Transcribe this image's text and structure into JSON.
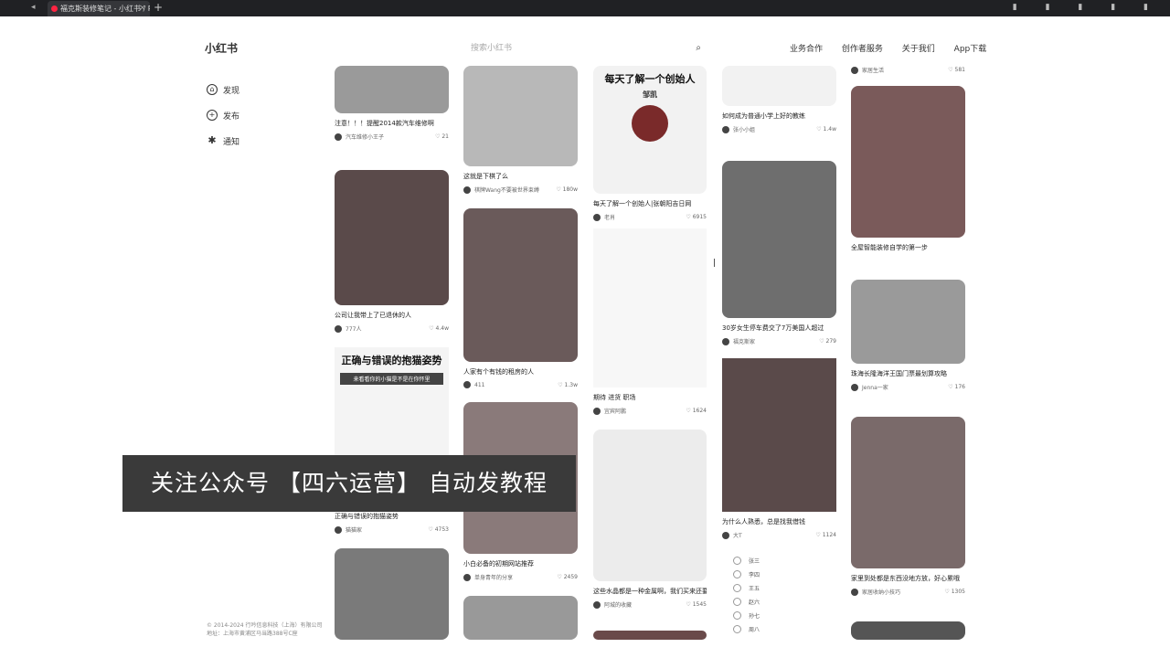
{
  "browser": {
    "tab_title": "福克斯装修笔记 - 小红书 / RED",
    "close_label": "×",
    "new_tab_label": "+",
    "back_label": "◂",
    "window_controls": "▮ ▮ ▮ ▮ ▮"
  },
  "header": {
    "logo": "小红书",
    "search_placeholder": "搜索小红书",
    "search_icon": "search-icon",
    "nav": [
      "业务合作",
      "创作者服务",
      "关于我们",
      "App下载"
    ]
  },
  "sidebar": {
    "items": [
      {
        "label": "发现",
        "icon": "home-icon",
        "glyph": "⌂"
      },
      {
        "label": "发布",
        "icon": "plus-icon",
        "glyph": "+"
      },
      {
        "label": "通知",
        "icon": "bell-icon",
        "glyph": "✱"
      }
    ],
    "footer": "© 2014-2024 行吟信息科技（上海）有限公司\n地址：上海市黄浦区马当路388号C座"
  },
  "overlay_text": "关注公众号 【四六运营】 自动发教程",
  "cards": [
    {
      "title": "注意！！！提醒2014款汽车维修啊",
      "author": "汽车维修小王子",
      "likes": "21"
    },
    {
      "title": "公司让我带上了已退休的人",
      "author": "777人",
      "likes": "4.4w"
    },
    {
      "title": "正确与错误的抱猫姿势",
      "image_title": "正确与错误的抱猫姿势",
      "image_sub": "来看看你的小猫是不是在你怀里",
      "author": "猫猫家",
      "likes": "4753"
    },
    {
      "title": "这就是下棋了么",
      "author": "棋牌Wang不要被世界束缚",
      "likes": "180w"
    },
    {
      "title": "人家有个有钱的租房的人",
      "author": "411",
      "likes": "1.3w"
    },
    {
      "title": "小白必备的初期网站推荐",
      "author": "单身青年的分享",
      "likes": "2459"
    },
    {
      "title": "每天了解一个创始人|张朝阳吉日网",
      "image_title": "每天了解一个创始人",
      "image_sub": "邹凯",
      "author": "老肖",
      "likes": "6915"
    },
    {
      "title": "期待 进货 职场",
      "author": "宜宾阿鹏",
      "likes": "1624"
    },
    {
      "title": "这些水晶都是一种金属啊，我们买来还要吗",
      "author": "阿城的收藏",
      "likes": "1545"
    },
    {
      "title": "如何成为普通小学上好的教练",
      "author": "张小小姐",
      "likes": "1.4w"
    },
    {
      "title": "30岁女生停车费交了7万美国人超过",
      "author": "福克斯家",
      "likes": "279"
    },
    {
      "title": "为什么人熟悉，总是找我借钱",
      "author": "大T",
      "likes": "1124"
    },
    {
      "title": "全屋智能装修自学的第一步",
      "author": "家居生活",
      "likes": "581"
    },
    {
      "title": "珠海长隆海洋王国门票最划算攻略",
      "author": "Jenna一家",
      "likes": "176"
    },
    {
      "title": "家里到处都是东西没地方放，好心累哦",
      "author": "家居收纳小技巧",
      "likes": "1305"
    }
  ],
  "list_items": [
    "张三",
    "李四",
    "王五",
    "赵六",
    "孙七",
    "周八"
  ]
}
